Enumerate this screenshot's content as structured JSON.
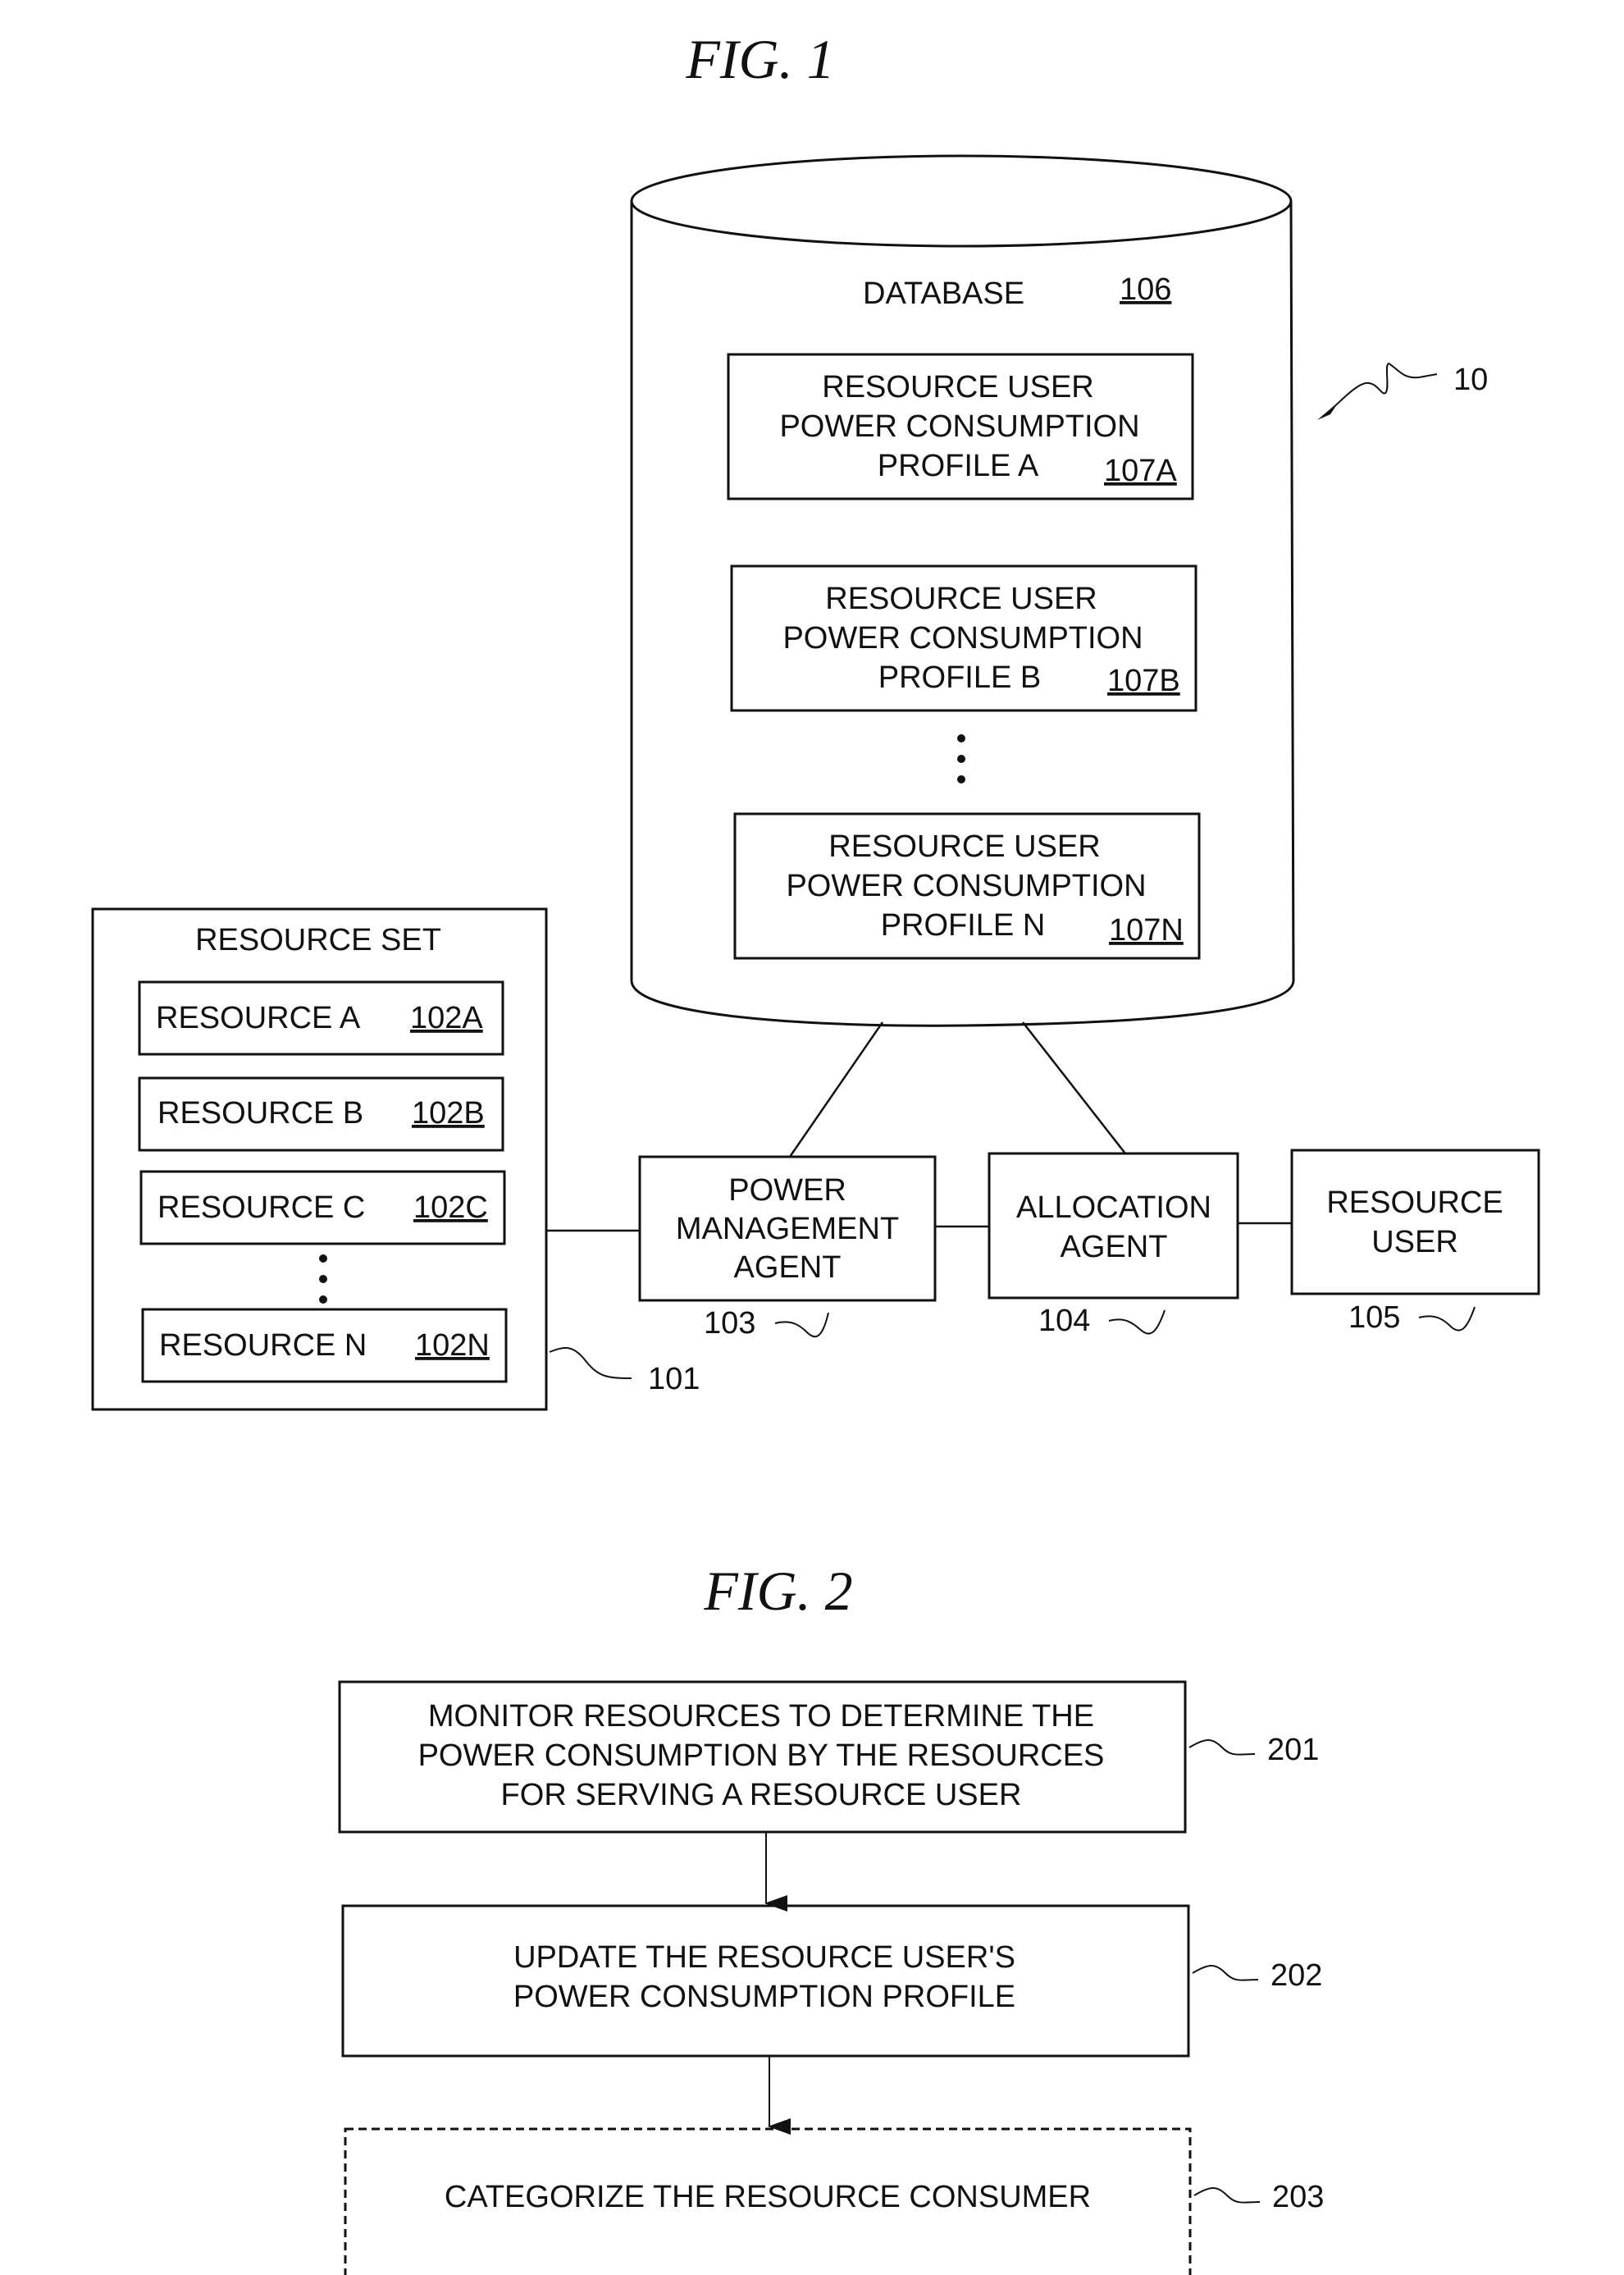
{
  "fig1": {
    "title": "FIG. 1",
    "system_ref": "10",
    "database": {
      "label": "DATABASE",
      "ref": "106"
    },
    "profiles": [
      {
        "line1": "RESOURCE USER",
        "line2": "POWER CONSUMPTION",
        "line3": "PROFILE A",
        "ref": "107A"
      },
      {
        "line1": "RESOURCE USER",
        "line2": "POWER CONSUMPTION",
        "line3": "PROFILE B",
        "ref": "107B"
      },
      {
        "line1": "RESOURCE USER",
        "line2": "POWER CONSUMPTION",
        "line3": "PROFILE N",
        "ref": "107N"
      }
    ],
    "resource_set": {
      "label": "RESOURCE SET",
      "ref": "101",
      "resources": [
        {
          "label": "RESOURCE A",
          "ref": "102A"
        },
        {
          "label": "RESOURCE B",
          "ref": "102B"
        },
        {
          "label": "RESOURCE C",
          "ref": "102C"
        },
        {
          "label": "RESOURCE N",
          "ref": "102N"
        }
      ]
    },
    "power_agent": {
      "line1": "POWER",
      "line2": "MANAGEMENT",
      "line3": "AGENT",
      "ref": "103"
    },
    "allocation_agent": {
      "line1": "ALLOCATION",
      "line2": "AGENT",
      "ref": "104"
    },
    "resource_user": {
      "line1": "RESOURCE",
      "line2": "USER",
      "ref": "105"
    }
  },
  "fig2": {
    "title": "FIG. 2",
    "steps": [
      {
        "lines": [
          "MONITOR RESOURCES TO DETERMINE THE",
          "POWER CONSUMPTION BY THE RESOURCES",
          "FOR SERVING A RESOURCE USER"
        ],
        "ref": "201"
      },
      {
        "lines": [
          "UPDATE THE RESOURCE USER'S",
          "POWER CONSUMPTION PROFILE"
        ],
        "ref": "202"
      },
      {
        "lines": [
          "CATEGORIZE THE RESOURCE CONSUMER"
        ],
        "ref": "203"
      }
    ]
  }
}
